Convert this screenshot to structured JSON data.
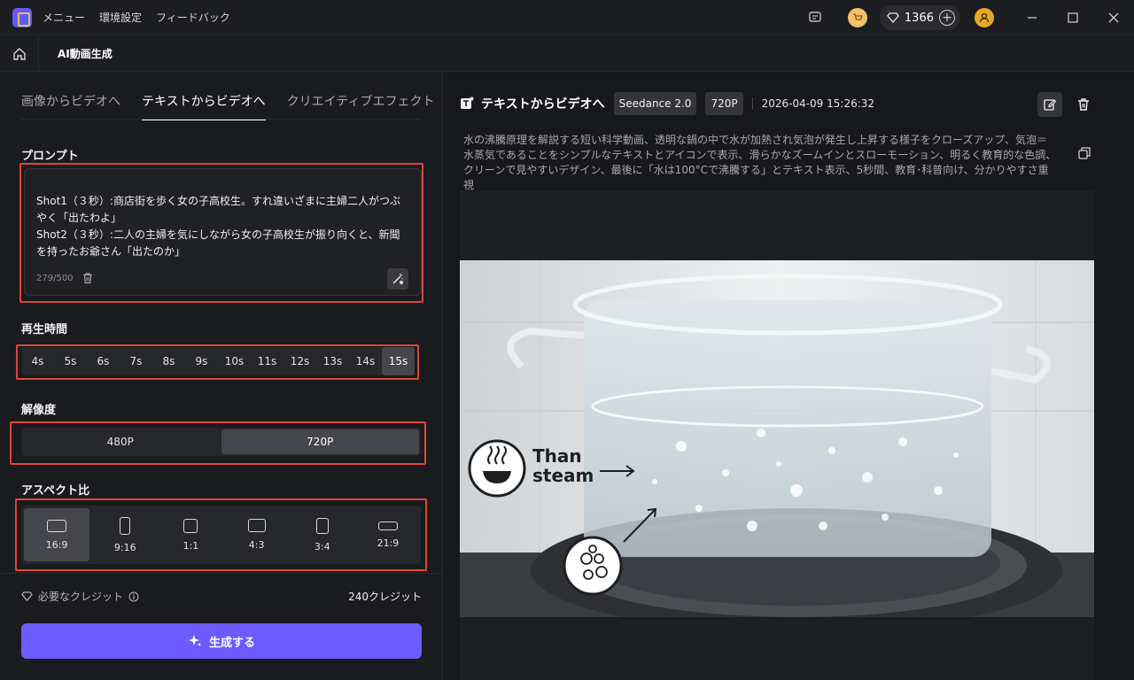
{
  "titlebar": {
    "menu": [
      "メニュー",
      "環境設定",
      "フィードバック"
    ],
    "credits": "1366"
  },
  "subbar": {
    "title": "AI動画生成"
  },
  "tabs": [
    "画像からビデオへ",
    "テキストからビデオへ",
    "クリエイティブエフェクト"
  ],
  "active_tab": 1,
  "prompt": {
    "label": "プロンプト",
    "text": "Shot1（３秒）:商店街を歩く女の子高校生。すれ違いざまに主婦二人がつぶやく「出たわよ」\nShot2（３秒）:二人の主婦を気にしながら女の子高校生が振り向くと、新聞を持ったお爺さん「出たのか」",
    "count": "279/500"
  },
  "duration": {
    "label": "再生時間",
    "options": [
      "4s",
      "5s",
      "6s",
      "7s",
      "8s",
      "9s",
      "10s",
      "11s",
      "12s",
      "13s",
      "14s",
      "15s"
    ],
    "selected": "15s"
  },
  "resolution": {
    "label": "解像度",
    "options": [
      "480P",
      "720P"
    ],
    "selected": "720P"
  },
  "aspect": {
    "label": "アスペクト比",
    "options": [
      "16:9",
      "9:16",
      "1:1",
      "4:3",
      "3:4",
      "21:9"
    ],
    "selected": "16:9"
  },
  "credits_needed": {
    "label": "必要なクレジット",
    "value": "240クレジット"
  },
  "generate_label": "生成する",
  "result": {
    "title": "テキストからビデオへ",
    "model": "Seedance 2.0",
    "resolution": "720P",
    "datetime": "2026-04-09 15:26:32",
    "description": "水の沸騰原理を解説する短い科学動画、透明な鍋の中で水が加熱され気泡が発生し上昇する様子をクローズアップ、気泡＝水蒸気であることをシンプルなテキストとアイコンで表示、滑らかなズームインとスローモーション、明るく教育的な色調、クリーンで見やすいデザイン、最後に「水は100°Cで沸騰する」とテキスト表示、5秒間、教育･科普向け、分かりやすさ重視",
    "video_caption": "Than\nsteam"
  },
  "colors": {
    "accent": "#6c5cff",
    "highlight": "#e0453a"
  }
}
